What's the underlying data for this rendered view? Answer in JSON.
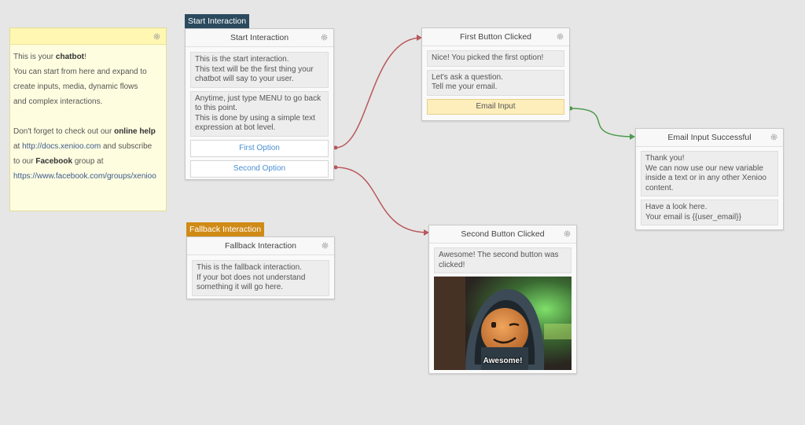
{
  "note": {
    "line1_pre": "This is your ",
    "line1_bold": "chatbot",
    "line1_post": "!",
    "line2": "You can start from here and expand to",
    "line3": "create inputs, media, dynamic flows",
    "line4": "and complex interactions.",
    "line5_pre": "Don't forget to check out our ",
    "line5_bold": "online help",
    "line6_pre": "at ",
    "line6_link": "http://docs.xenioo.com",
    "line6_post": " and subscribe",
    "line7_pre": "to our ",
    "line7_bold": "Facebook",
    "line7_post": " group at",
    "line8_link": "https://www.facebook.com/groups/xenioo"
  },
  "start": {
    "tag": "Start Interaction",
    "title": "Start Interaction",
    "msg1": "This is the start interaction.\nThis text will be the first thing your\nchatbot will say to your user.",
    "msg2": "Anytime, just type MENU to go back\nto this point.\nThis is done by using a simple text\nexpression at bot level.",
    "opt1": "First Option",
    "opt2": "Second Option"
  },
  "fallback": {
    "tag": "Fallback Interaction",
    "title": "Fallback Interaction",
    "msg1": "This is the fallback interaction.\nIf your bot does not understand\nsomething it will go here."
  },
  "first": {
    "title": "First Button Clicked",
    "msg1": "Nice! You picked the first option!",
    "msg2": "Let's ask a question.\nTell me your email.",
    "input": "Email Input"
  },
  "email": {
    "title": "Email Input Successful",
    "msg1": "Thank you!\nWe can now use our new variable\ninside a text or in any other Xenioo\ncontent.",
    "msg2": "Have a look here.\nYour email is {{user_email}}"
  },
  "second": {
    "title": "Second Button Clicked",
    "msg1": "Awesome! The second button was\nclicked!",
    "gif_caption": "Awesome!"
  },
  "icons": {
    "gear": "gear-icon"
  },
  "colors": {
    "connector_red": "#b9575b",
    "connector_green": "#4f9a4f",
    "start_tag": "#2b4a5e",
    "fallback_tag": "#d08a16"
  }
}
